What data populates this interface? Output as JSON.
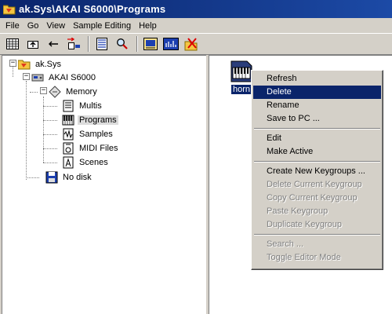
{
  "window": {
    "title": "ak.Sys\\AKAI S6000\\Programs"
  },
  "menu": [
    "File",
    "Go",
    "View",
    "Sample Editing",
    "Help"
  ],
  "toolbar": {
    "buttons": [
      "view-list",
      "up-folder",
      "back",
      "connect",
      "details",
      "find",
      "editor",
      "meter",
      "disconnect"
    ]
  },
  "tree": {
    "root": "ak.Sys",
    "device": "AKAI S6000",
    "memory": "Memory",
    "children": [
      "Multis",
      "Programs",
      "Samples",
      "MIDI Files",
      "Scenes"
    ],
    "selected": "Programs",
    "no_disk": "No disk"
  },
  "files": [
    {
      "label": "horn"
    }
  ],
  "context_menu": {
    "items": [
      {
        "label": "Refresh",
        "enabled": true
      },
      {
        "label": "Delete",
        "enabled": true,
        "highlighted": true
      },
      {
        "label": "Rename",
        "enabled": true
      },
      {
        "label": "Save to PC ...",
        "enabled": true
      },
      {
        "sep": true
      },
      {
        "label": "Edit",
        "enabled": true
      },
      {
        "label": "Make Active",
        "enabled": true
      },
      {
        "sep": true
      },
      {
        "label": "Create New Keygroups ...",
        "enabled": true
      },
      {
        "label": "Delete Current Keygroup",
        "enabled": false
      },
      {
        "label": "Copy Current Keygroup",
        "enabled": false
      },
      {
        "label": "Paste Keygroup",
        "enabled": false
      },
      {
        "label": "Duplicate Keygroup",
        "enabled": false
      },
      {
        "sep": true
      },
      {
        "label": "Search ...",
        "enabled": false
      },
      {
        "label": "Toggle Editor Mode",
        "enabled": false
      }
    ]
  }
}
